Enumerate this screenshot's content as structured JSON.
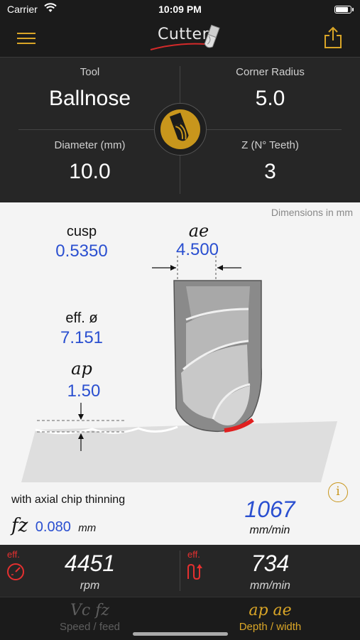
{
  "status": {
    "carrier": "Carrier",
    "time": "10:09 PM"
  },
  "navbar": {
    "logo_text": "Cutter"
  },
  "tool_panel": {
    "tool": {
      "label": "Tool",
      "value": "Ballnose"
    },
    "corner_radius": {
      "label": "Corner Radius",
      "value": "5.0"
    },
    "diameter": {
      "label": "Diameter (mm)",
      "value": "10.0"
    },
    "teeth": {
      "label": "Z (N° Teeth)",
      "value": "3"
    }
  },
  "diagram": {
    "dimensions_note": "Dimensions in mm",
    "cusp": {
      "label": "cusp",
      "value": "0.5350"
    },
    "ae": {
      "label": "ae",
      "value": "4.500"
    },
    "eff_diameter": {
      "label": "eff. ø",
      "value": "7.151"
    },
    "ap": {
      "label": "ap",
      "value": "1.50"
    },
    "info_symbol": "i",
    "chip_thinning_note": "with axial chip thinning",
    "fz": {
      "symbol": "fz",
      "value": "0.080",
      "unit": "mm"
    },
    "feed": {
      "value": "1067",
      "unit": "mm/min"
    }
  },
  "results": {
    "speed": {
      "eff_label": "eff.",
      "value": "4451",
      "unit": "rpm"
    },
    "feed": {
      "eff_label": "eff.",
      "value": "734",
      "unit": "mm/min"
    }
  },
  "tabs": [
    {
      "symbol": "Vc  fz",
      "label": "Speed / feed",
      "active": false
    },
    {
      "symbol": "ap ae",
      "label": "Depth / width",
      "active": true
    }
  ],
  "colors": {
    "accent": "#d9a527",
    "value_blue": "#2a4fd0",
    "effective_red": "#e53030"
  }
}
